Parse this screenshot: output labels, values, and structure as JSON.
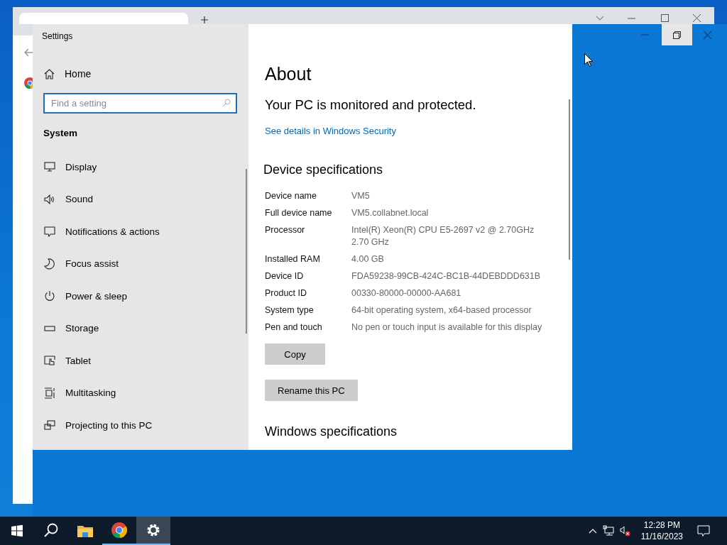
{
  "settings_window": {
    "title": "Settings",
    "sidebar": {
      "home": "Home",
      "search": {
        "placeholder": "Find a setting"
      },
      "section": "System",
      "items": [
        {
          "label": "Display",
          "kind": "display",
          "selected": false
        },
        {
          "label": "Sound",
          "kind": "sound",
          "selected": false
        },
        {
          "label": "Notifications & actions",
          "kind": "notifications",
          "selected": false
        },
        {
          "label": "Focus assist",
          "kind": "focus",
          "selected": false
        },
        {
          "label": "Power & sleep",
          "kind": "power",
          "selected": false
        },
        {
          "label": "Storage",
          "kind": "storage",
          "selected": false
        },
        {
          "label": "Tablet",
          "kind": "tablet",
          "selected": false
        },
        {
          "label": "Multitasking",
          "kind": "multitasking",
          "selected": false
        },
        {
          "label": "Projecting to this PC",
          "kind": "projecting",
          "selected": false
        }
      ]
    },
    "content": {
      "heading": "About",
      "status": "Your PC is monitored and protected.",
      "link": "See details in Windows Security",
      "device_specs": {
        "title": "Device specifications",
        "rows": [
          {
            "label": "Device name",
            "value": "VM5"
          },
          {
            "label": "Full device name",
            "value": "VM5.collabnet.local"
          },
          {
            "label": "Processor",
            "value": "Intel(R) Xeon(R) CPU E5-2697 v2 @ 2.70GHz\n2.70 GHz"
          },
          {
            "label": "Installed RAM",
            "value": "4.00 GB"
          },
          {
            "label": "Device ID",
            "value": "FDA59238-99CB-424C-BC1B-44DEBDDD631B"
          },
          {
            "label": "Product ID",
            "value": "00330-80000-00000-AA681"
          },
          {
            "label": "System type",
            "value": "64-bit operating system, x64-based processor"
          },
          {
            "label": "Pen and touch",
            "value": "No pen or touch input is available for this display"
          }
        ],
        "buttons": [
          "Copy",
          "Rename this PC"
        ]
      },
      "windows_specs_title": "Windows specifications"
    }
  },
  "taskbar": {
    "apps": [
      {
        "kind": "start",
        "running": false,
        "selected": false
      },
      {
        "kind": "search",
        "running": false,
        "selected": false
      },
      {
        "kind": "files",
        "running": false,
        "selected": false
      },
      {
        "kind": "chrome",
        "running": true,
        "selected": false
      },
      {
        "kind": "settings",
        "running": true,
        "selected": true
      }
    ],
    "clock": {
      "time": "12:28 PM",
      "date": "11/16/2023"
    }
  }
}
